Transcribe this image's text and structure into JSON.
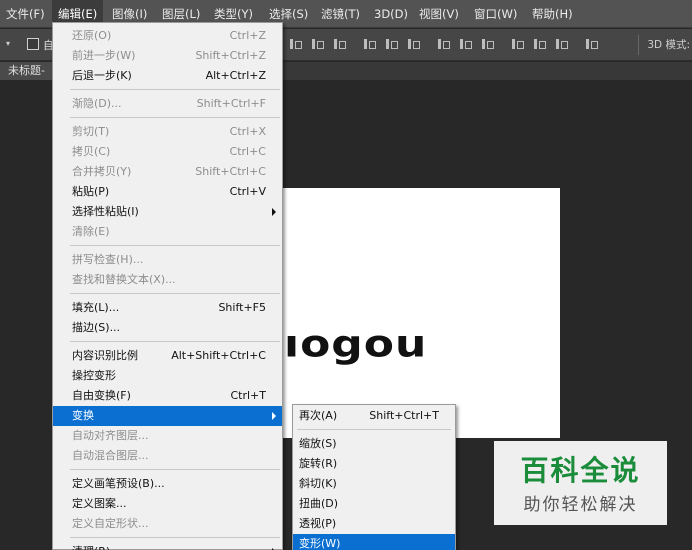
{
  "menubar": {
    "items": [
      {
        "label": "文件(F)"
      },
      {
        "label": "编辑(E)"
      },
      {
        "label": "图像(I)"
      },
      {
        "label": "图层(L)"
      },
      {
        "label": "类型(Y)"
      },
      {
        "label": "选择(S)"
      },
      {
        "label": "滤镜(T)"
      },
      {
        "label": "3D(D)"
      },
      {
        "label": "视图(V)"
      },
      {
        "label": "窗口(W)"
      },
      {
        "label": "帮助(H)"
      }
    ]
  },
  "options_bar": {
    "checkbox_label": "自",
    "mode_label": "3D 模式:"
  },
  "document": {
    "tab_label": "未标题-",
    "artwork_text": "ıogou"
  },
  "edit_menu": {
    "items": [
      {
        "label": "还原(O)",
        "shortcut": "Ctrl+Z"
      },
      {
        "label": "前进一步(W)",
        "shortcut": "Shift+Ctrl+Z"
      },
      {
        "label": "后退一步(K)",
        "shortcut": "Alt+Ctrl+Z"
      },
      {
        "label": "渐隐(D)...",
        "shortcut": "Shift+Ctrl+F"
      },
      {
        "label": "剪切(T)",
        "shortcut": "Ctrl+X"
      },
      {
        "label": "拷贝(C)",
        "shortcut": "Ctrl+C"
      },
      {
        "label": "合并拷贝(Y)",
        "shortcut": "Shift+Ctrl+C"
      },
      {
        "label": "粘贴(P)",
        "shortcut": "Ctrl+V"
      },
      {
        "label": "选择性粘贴(I)",
        "shortcut": ""
      },
      {
        "label": "清除(E)",
        "shortcut": ""
      },
      {
        "label": "拼写检查(H)...",
        "shortcut": ""
      },
      {
        "label": "查找和替换文本(X)...",
        "shortcut": ""
      },
      {
        "label": "填充(L)...",
        "shortcut": "Shift+F5"
      },
      {
        "label": "描边(S)...",
        "shortcut": ""
      },
      {
        "label": "内容识别比例",
        "shortcut": "Alt+Shift+Ctrl+C"
      },
      {
        "label": "操控变形",
        "shortcut": ""
      },
      {
        "label": "自由变换(F)",
        "shortcut": "Ctrl+T"
      },
      {
        "label": "变换",
        "shortcut": ""
      },
      {
        "label": "自动对齐图层...",
        "shortcut": ""
      },
      {
        "label": "自动混合图层...",
        "shortcut": ""
      },
      {
        "label": "定义画笔预设(B)...",
        "shortcut": ""
      },
      {
        "label": "定义图案...",
        "shortcut": ""
      },
      {
        "label": "定义自定形状...",
        "shortcut": ""
      },
      {
        "label": "清理(R)",
        "shortcut": ""
      }
    ]
  },
  "transform_submenu": {
    "items": [
      {
        "label": "再次(A)",
        "shortcut": "Shift+Ctrl+T"
      },
      {
        "label": "缩放(S)",
        "shortcut": ""
      },
      {
        "label": "旋转(R)",
        "shortcut": ""
      },
      {
        "label": "斜切(K)",
        "shortcut": ""
      },
      {
        "label": "扭曲(D)",
        "shortcut": ""
      },
      {
        "label": "透视(P)",
        "shortcut": ""
      },
      {
        "label": "变形(W)",
        "shortcut": ""
      }
    ]
  },
  "watermark": {
    "title": "百科全说",
    "subtitle": "助你轻松解决"
  },
  "colors": {
    "highlight": "#0a6fd1",
    "menubar": "#535353",
    "workspace": "#282828",
    "watermark_green": "#1a8c3a"
  }
}
